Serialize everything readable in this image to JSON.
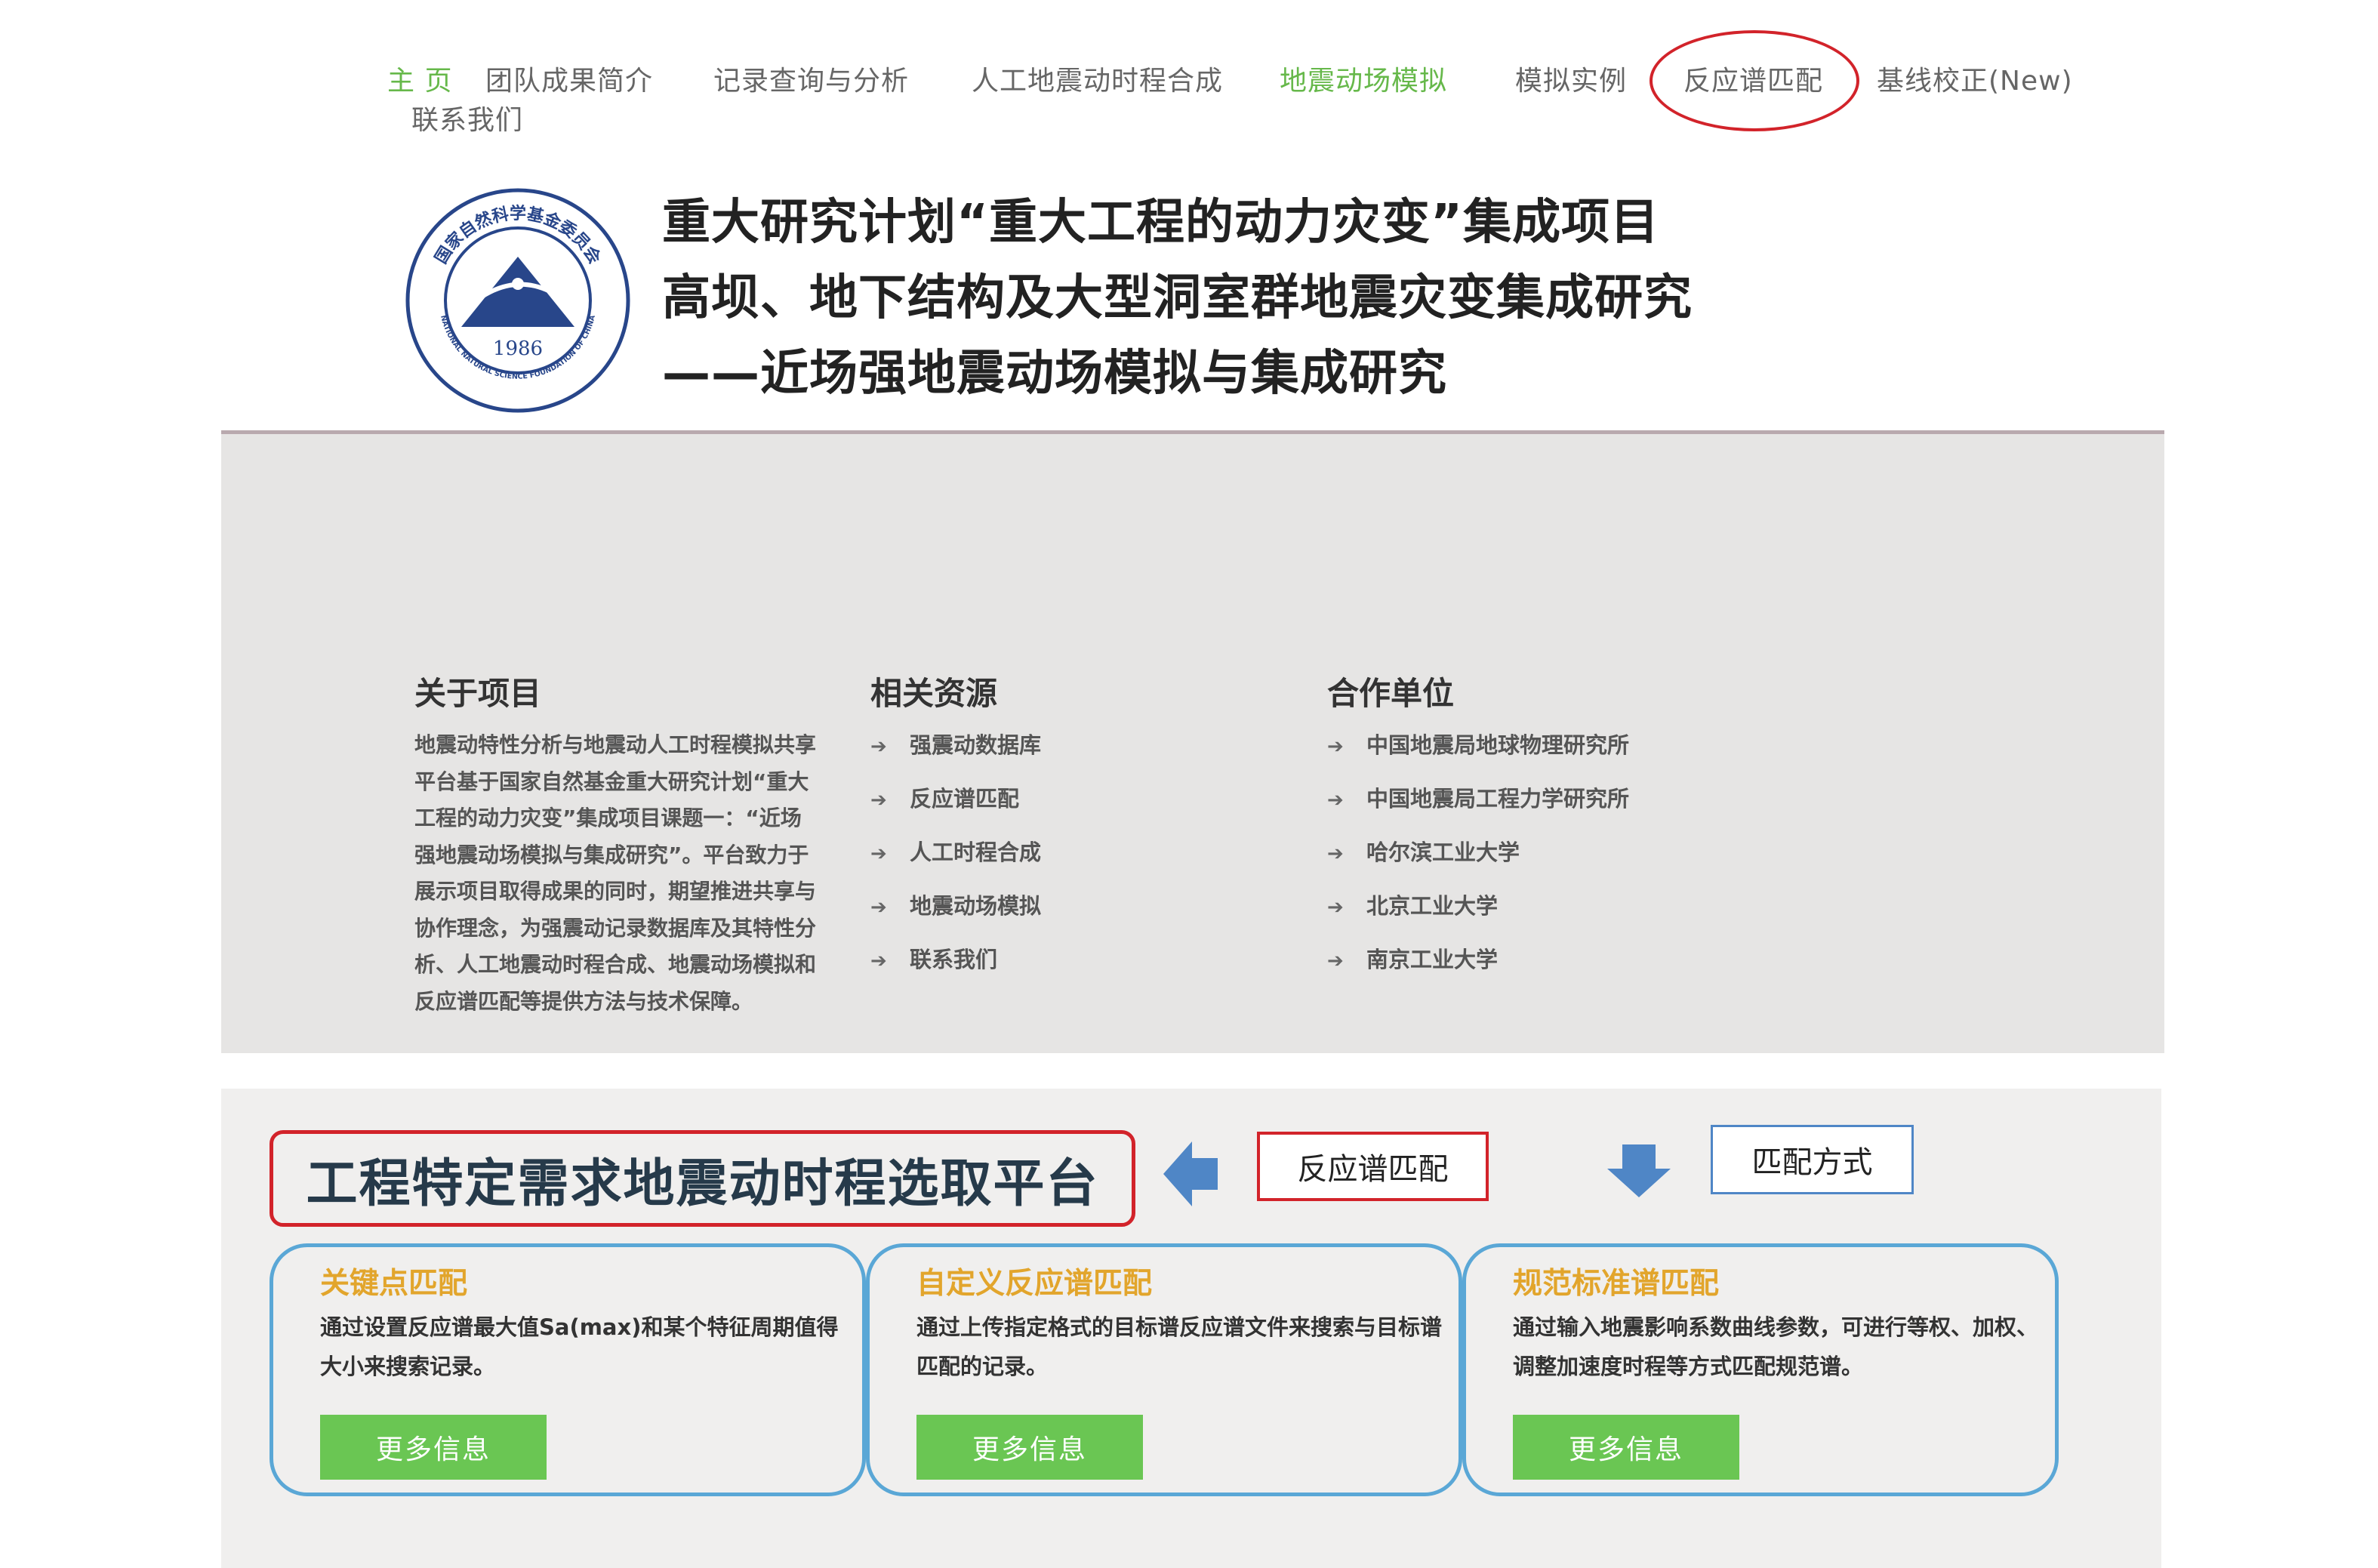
{
  "nav": {
    "items": [
      {
        "label": "主 页",
        "active": true
      },
      {
        "label": "团队成果简介"
      },
      {
        "label": "记录查询与分析"
      },
      {
        "label": "人工地震动时程合成"
      },
      {
        "label": "地震动场模拟",
        "active": true
      },
      {
        "label": "模拟实例"
      },
      {
        "label": "反应谱匹配",
        "highlighted": true
      },
      {
        "label": "基线校正(New)"
      },
      {
        "label": "联系我们"
      }
    ]
  },
  "header": {
    "logo": {
      "text_top": "国家自然科学基金委员会",
      "text_bottom": "NATIONAL NATURAL SCIENCE FOUNDATION OF CHINA",
      "year": "1986"
    },
    "lines": [
      "重大研究计划“重大工程的动力灾变”集成项目",
      "高坝、地下结构及大型洞室群地震灾变集成研究",
      "——近场强地震动场模拟与集成研究"
    ]
  },
  "footer_panel": {
    "about": {
      "title": "关于项目",
      "text": "地震动特性分析与地震动人工时程模拟共享平台基于国家自然基金重大研究计划“重大工程的动力灾变”集成项目课题一：“近场强地震动场模拟与集成研究”。平台致力于展示项目取得成果的同时，期望推进共享与协作理念，为强震动记录数据库及其特性分析、人工地震动时程合成、地震动场模拟和反应谱匹配等提供方法与技术保障。"
    },
    "resources": {
      "title": "相关资源",
      "links": [
        "强震动数据库",
        "反应谱匹配",
        "人工时程合成",
        "地震动场模拟",
        "联系我们"
      ]
    },
    "partners": {
      "title": "合作单位",
      "links": [
        "中国地震局地球物理研究所",
        "中国地震局工程力学研究所",
        "哈尔滨工业大学",
        "北京工业大学",
        "南京工业大学"
      ]
    }
  },
  "platform": {
    "title": "工程特定需求地震动时程选取平台",
    "label_match": "反应谱匹配",
    "label_mode": "匹配方式",
    "cards": [
      {
        "title": "关键点匹配",
        "desc": "通过设置反应谱最大值Sa(max)和某个特征周期值得大小来搜索记录。",
        "button": "更多信息"
      },
      {
        "title": "自定义反应谱匹配",
        "desc": "通过上传指定格式的目标谱反应谱文件来搜索与目标谱匹配的记录。",
        "button": "更多信息"
      },
      {
        "title": "规范标准谱匹配",
        "desc": "通过输入地震影响系数曲线参数，可进行等权、加权、调整加速度时程等方式匹配规范谱。",
        "button": "更多信息"
      }
    ]
  },
  "colors": {
    "nav_active": "#66b84a",
    "highlight_red": "#d2232a",
    "card_border": "#5aa7d6",
    "card_title": "#e2a52c",
    "button_green": "#6ac653",
    "arrow_blue": "#4f86c6",
    "panel_gray": "#e6e5e4"
  },
  "icons": [
    "nsfc-logo",
    "arrow-left-icon",
    "arrow-down-icon",
    "link-arrow-icon"
  ]
}
